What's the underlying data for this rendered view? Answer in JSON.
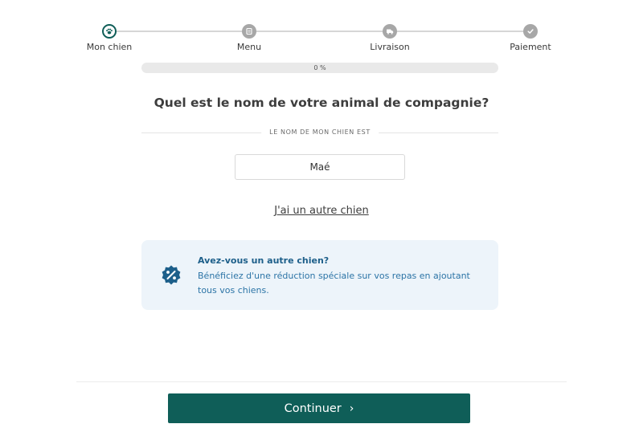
{
  "stepper": {
    "steps": [
      {
        "label": "Mon chien",
        "icon": "paw-icon",
        "active": true
      },
      {
        "label": "Menu",
        "icon": "menu-icon",
        "active": false
      },
      {
        "label": "Livraison",
        "icon": "truck-icon",
        "active": false
      },
      {
        "label": "Paiement",
        "icon": "check-icon",
        "active": false
      }
    ]
  },
  "progress": {
    "percent": 0,
    "label": "0 %"
  },
  "question": "Quel est le nom de votre animal de compagnie?",
  "field_label": "LE NOM DE MON CHIEN EST",
  "dog_name": {
    "value": "Maé"
  },
  "other_dog_link": "J'ai un autre chien",
  "info": {
    "icon": "discount-badge-icon",
    "title": "Avez-vous un autre chien?",
    "body": "Bénéficiez d'une réduction spéciale sur vos repas en ajoutant tous vos chiens."
  },
  "continue_button": {
    "label": "Continuer",
    "icon": "chevron-right-icon"
  },
  "colors": {
    "primary": "#0f5e58",
    "info_bg": "#edf4fa",
    "info_text": "#2c74a6",
    "inactive_step": "#a7a7a7"
  }
}
